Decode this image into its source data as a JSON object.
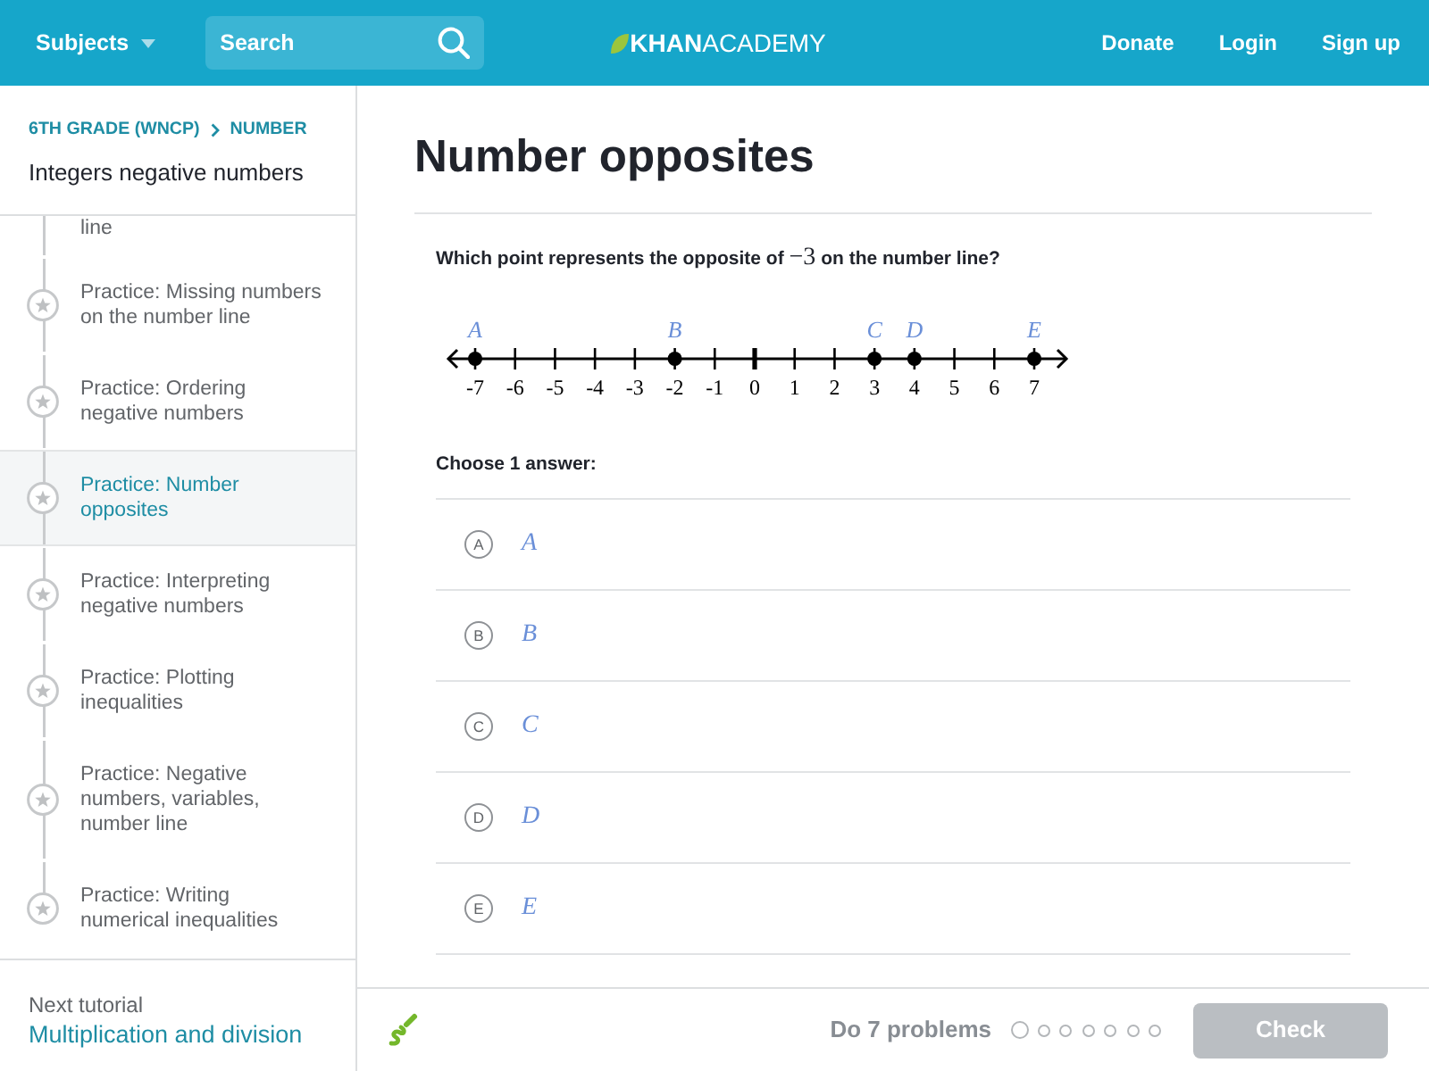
{
  "header": {
    "subjects_menu": {
      "label": "Subjects"
    },
    "search": {
      "placeholder": "Search"
    },
    "logo": {
      "text": "**KHAN**ACADEMY"
    },
    "links": [
      "Donate",
      "Login",
      "Sign up"
    ]
  },
  "sidebar": {
    "breadcrumb": [
      "6TH GRADE (WNCP)",
      "NUMBER"
    ],
    "title": "Integers negative numbers",
    "items": [
      {
        "kind": "continuation",
        "label": "line",
        "selected": false
      },
      {
        "kind": "practice",
        "label": "Practice: Missing numbers on the number line",
        "selected": false
      },
      {
        "kind": "practice",
        "label": "Practice: Ordering negative numbers",
        "selected": false
      },
      {
        "kind": "practice",
        "label": "Practice: Number opposites",
        "selected": true
      },
      {
        "kind": "practice",
        "label": "Practice: Interpreting negative numbers",
        "selected": false
      },
      {
        "kind": "practice",
        "label": "Practice: Plotting inequalities",
        "selected": false
      },
      {
        "kind": "practice",
        "label": "Practice: Negative numbers, variables, number line",
        "selected": false
      },
      {
        "kind": "practice",
        "label": "Practice: Writing numerical inequalities",
        "selected": false
      }
    ],
    "next_tutorial": {
      "caption": "Next tutorial",
      "link": "Multiplication and division"
    }
  },
  "exercise": {
    "title": "Number opposites",
    "question": {
      "before": "Which point represents the opposite of ",
      "math": "−3",
      "after": " on the number line?"
    },
    "number_line": {
      "ticks": [
        {
          "label": "-7",
          "major": false,
          "point": "A"
        },
        {
          "label": "-6",
          "major": false
        },
        {
          "label": "-5",
          "major": false
        },
        {
          "label": "-4",
          "major": false
        },
        {
          "label": "-3",
          "major": false
        },
        {
          "label": "-2",
          "major": false,
          "point": "B"
        },
        {
          "label": "-1",
          "major": false
        },
        {
          "label": "0",
          "major": true
        },
        {
          "label": "1",
          "major": false
        },
        {
          "label": "2",
          "major": false
        },
        {
          "label": "3",
          "major": false,
          "point": "C"
        },
        {
          "label": "4",
          "major": false,
          "point": "D"
        },
        {
          "label": "5",
          "major": false
        },
        {
          "label": "6",
          "major": false
        },
        {
          "label": "7",
          "major": false,
          "point": "E"
        }
      ]
    },
    "prompt": "Choose 1 answer:",
    "choices": [
      {
        "letter": "A",
        "answer": "A",
        "selected": false
      },
      {
        "letter": "B",
        "answer": "B",
        "selected": false
      },
      {
        "letter": "C",
        "answer": "C",
        "selected": false
      },
      {
        "letter": "D",
        "answer": "D",
        "selected": false
      },
      {
        "letter": "E",
        "answer": "E",
        "selected": false
      }
    ]
  },
  "footer": {
    "goal": "Do 7 problems",
    "progress": [
      {
        "current": true
      },
      {
        "current": false
      },
      {
        "current": false
      },
      {
        "current": false
      },
      {
        "current": false
      },
      {
        "current": false
      },
      {
        "current": false
      }
    ],
    "check_button": {
      "label": "Check",
      "disabled": true
    }
  }
}
